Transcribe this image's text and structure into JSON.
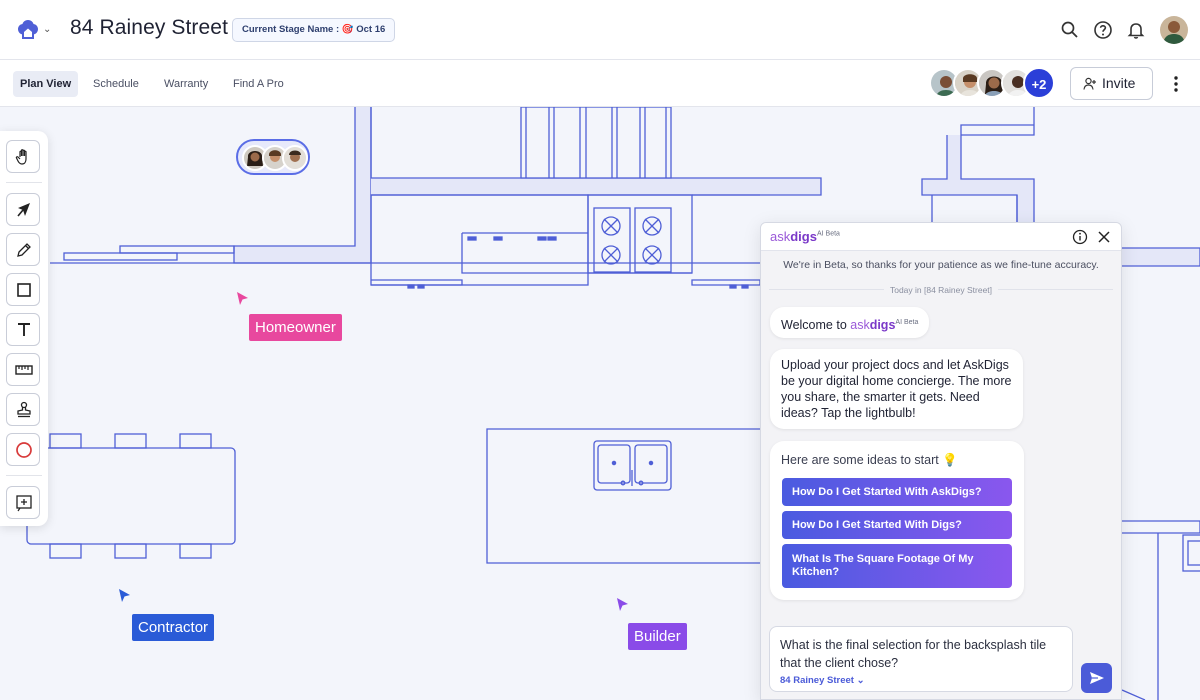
{
  "header": {
    "project_title": "84 Rainey Street",
    "stage_chip": "Current Stage Name : 🎯 Oct 16",
    "icons": [
      "home-logo-icon",
      "search-icon",
      "help-icon",
      "bell-icon"
    ]
  },
  "tabs": [
    {
      "label": "Plan View",
      "active": true
    },
    {
      "label": "Schedule",
      "active": false
    },
    {
      "label": "Warranty",
      "active": false
    },
    {
      "label": "Find A Pro",
      "active": false
    }
  ],
  "collaborators": {
    "extra_count": "+2",
    "invite_label": "Invite"
  },
  "toolbar": {
    "tools": [
      "hand-tool",
      "pointer-tool",
      "pencil-tool",
      "rectangle-tool",
      "text-tool",
      "ruler-tool",
      "stamp-tool",
      "circle-tool",
      "add-frame-tool"
    ]
  },
  "canvas": {
    "labels": {
      "homeowner": "Homeowner",
      "contractor": "Contractor",
      "builder": "Builder"
    },
    "colors": {
      "homeowner": "#e8489e",
      "contractor": "#2a5bd7",
      "builder": "#8a4be8",
      "plan_line": "#4f5fd6",
      "plan_fill": "#e4e7f8"
    }
  },
  "chat": {
    "brand_ask": "ask",
    "brand_digs": "digs",
    "brand_sup": "AI Beta",
    "beta_note": "We're in Beta, so thanks for your patience as we fine-tune accuracy.",
    "today": "Today in [84 Rainey Street]",
    "welcome_prefix": "Welcome to",
    "upload_message": "Upload your project docs and let AskDigs be your digital home concierge. The more you share, the smarter it gets. Need ideas? Tap the lightbulb!",
    "ideas_title": "Here are some ideas to start 💡",
    "ideas": [
      "How Do I Get Started With AskDigs?",
      "How Do I Get Started With Digs?",
      "What Is The Square Footage Of My Kitchen?"
    ],
    "input_value": "What is the final selection for the backsplash tile that the client chose?",
    "context_chip": "84 Rainey Street ⌄"
  }
}
